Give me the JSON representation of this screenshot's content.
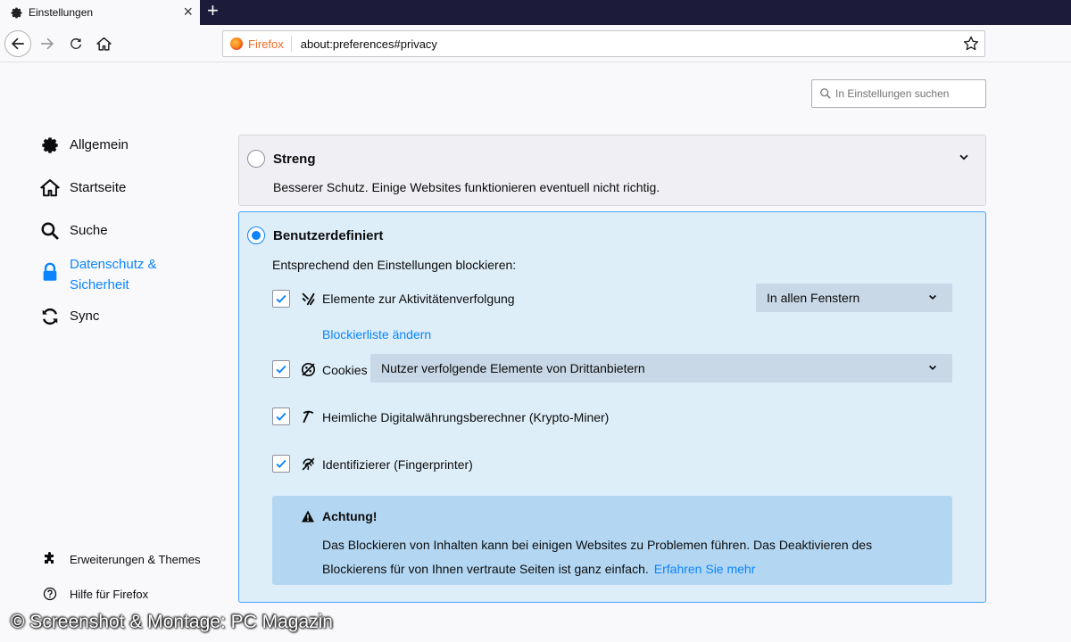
{
  "tab": {
    "title": "Einstellungen",
    "close": "×",
    "new_tab": "+"
  },
  "urlbar": {
    "identity": "Firefox",
    "url": "about:preferences#privacy"
  },
  "search": {
    "placeholder": "In Einstellungen suchen"
  },
  "sidebar": {
    "items": [
      {
        "label": "Allgemein",
        "icon": "gear-icon"
      },
      {
        "label": "Startseite",
        "icon": "home-icon"
      },
      {
        "label": "Suche",
        "icon": "search-icon"
      },
      {
        "label_line1": "Datenschutz &",
        "label_line2": "Sicherheit",
        "icon": "lock-icon",
        "active": true
      },
      {
        "label": "Sync",
        "icon": "sync-icon"
      }
    ],
    "footer": [
      {
        "label": "Erweiterungen & Themes",
        "icon": "puzzle-icon"
      },
      {
        "label": "Hilfe für Firefox",
        "icon": "help-icon"
      }
    ]
  },
  "streng": {
    "title": "Streng",
    "description": "Besserer Schutz. Einige Websites funktionieren eventuell nicht richtig."
  },
  "custom": {
    "title": "Benutzerdefiniert",
    "subtitle": "Entsprechend den Einstellungen blockieren:",
    "tracking": {
      "label": "Elemente zur Aktivitätenverfolgung",
      "checked": true,
      "dropdown": "In allen Fenstern"
    },
    "blocklist_link": "Blockierliste ändern",
    "cookies": {
      "label": "Cookies",
      "checked": true,
      "dropdown": "Nutzer verfolgende Elemente von Drittanbietern"
    },
    "cryptominers": {
      "label": "Heimliche Digitalwährungsberechner (Krypto-Miner)",
      "checked": true
    },
    "fingerprinters": {
      "label": "Identifizierer (Fingerprinter)",
      "checked": true
    }
  },
  "warning": {
    "title": "Achtung!",
    "text": "Das Blockieren von Inhalten kann bei einigen Websites zu Problemen führen. Das Deaktivieren des Blockierens für von Ihnen vertraute Seiten ist ganz einfach.",
    "link": "Erfahren Sie mehr"
  },
  "watermark": "© Screenshot & Montage: PC Magazin",
  "colors": {
    "accent": "#0a84ff",
    "card_selected_bg": "#ddeef9",
    "warning_bg": "#b3d7f2",
    "tabbar_bg": "#1c1b3a"
  }
}
